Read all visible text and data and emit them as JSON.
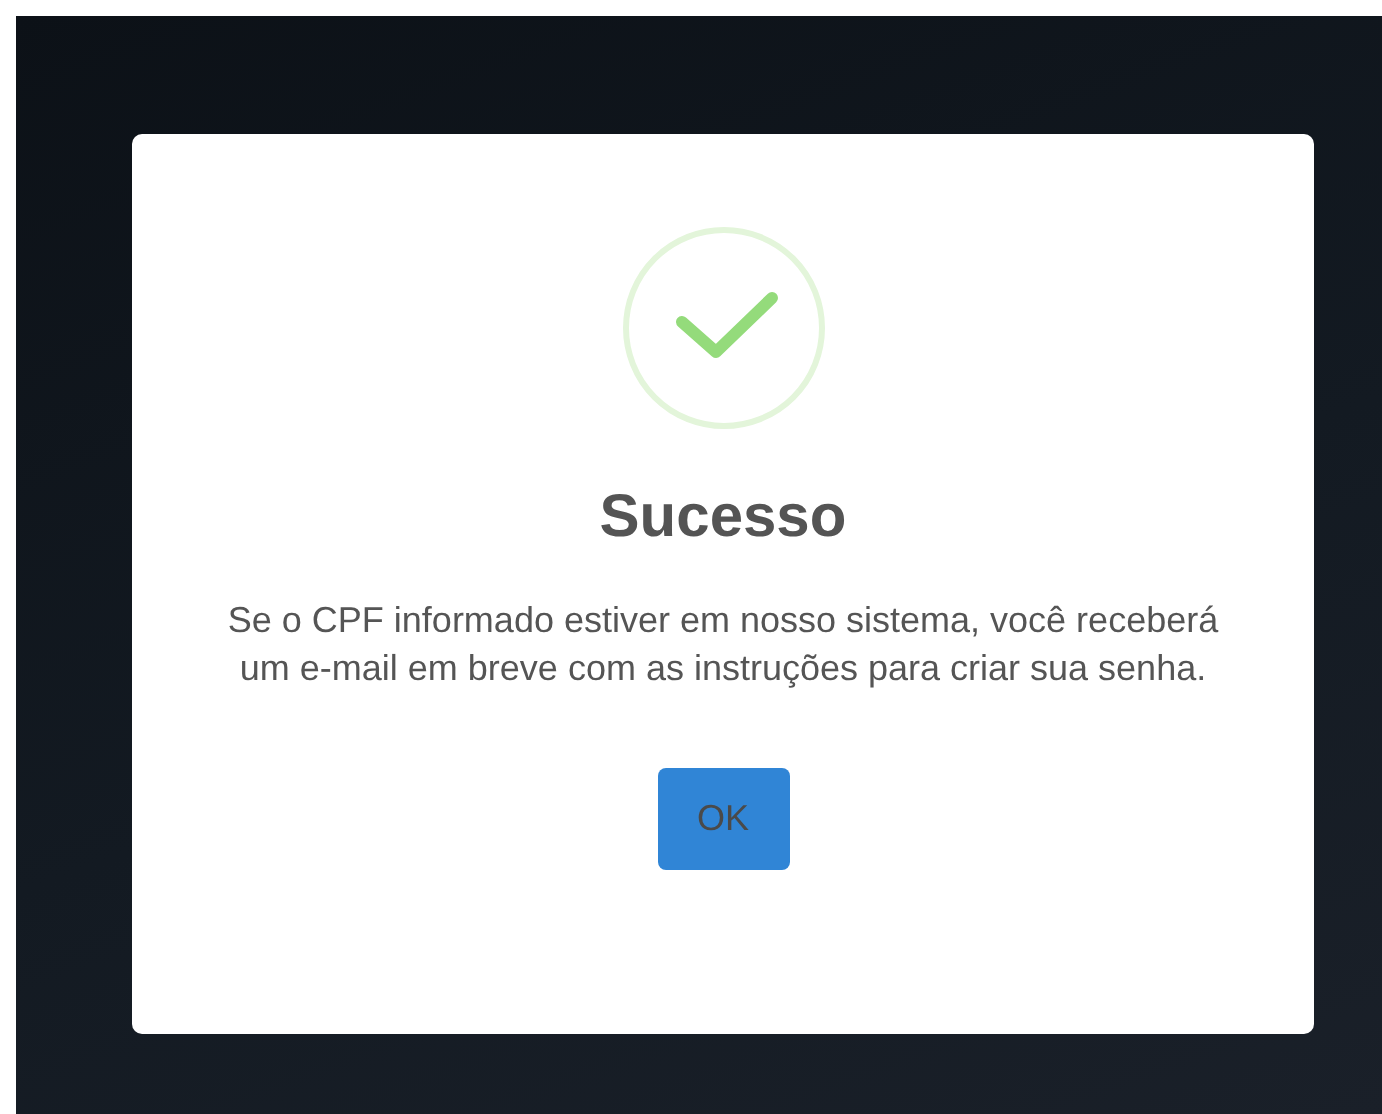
{
  "dialog": {
    "title": "Sucesso",
    "message": "Se o CPF informado estiver em nosso sistema, você receberá um e-mail em breve com as instruções para criar sua senha.",
    "buttons": [
      "OK"
    ]
  }
}
